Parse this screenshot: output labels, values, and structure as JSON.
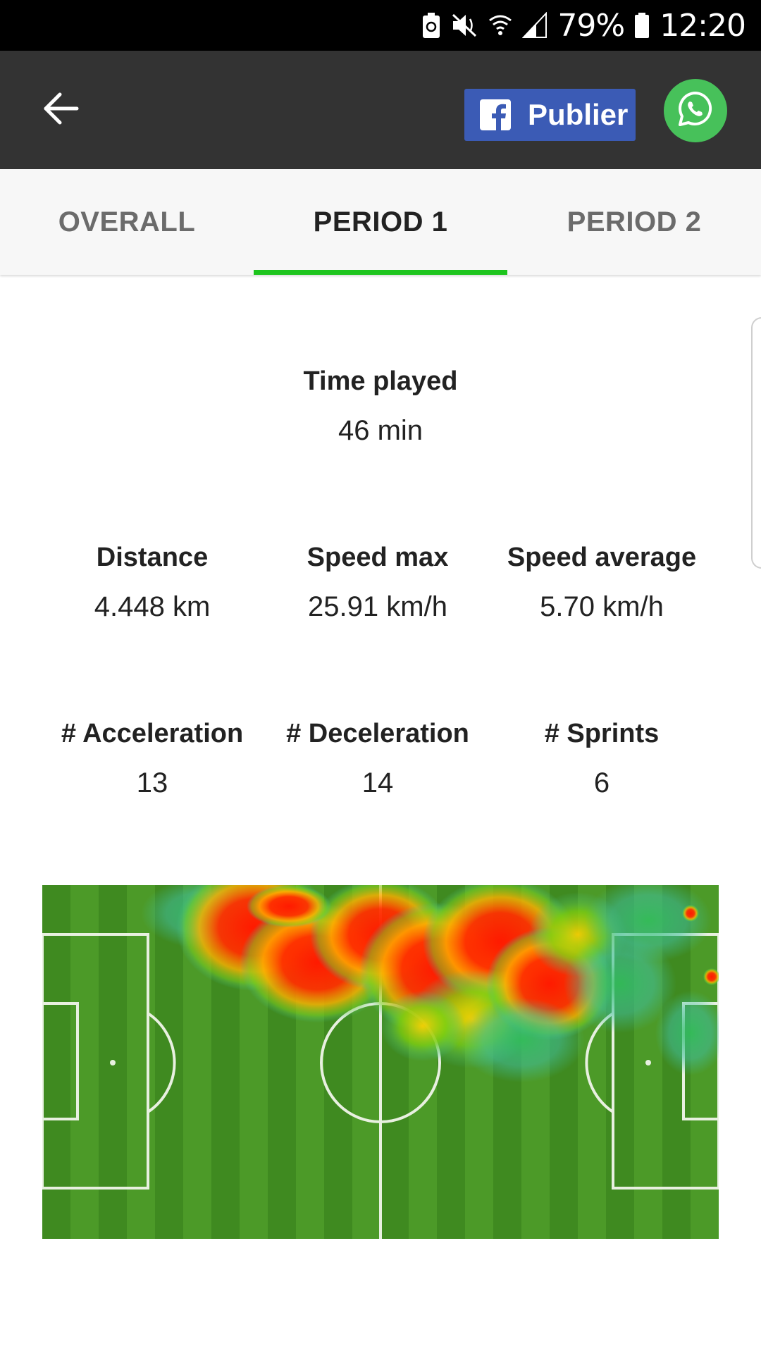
{
  "status_bar": {
    "battery_percent": "79%",
    "time": "12:20"
  },
  "app_bar": {
    "publish_label": "Publier"
  },
  "tabs": [
    {
      "label": "OVERALL",
      "active": false
    },
    {
      "label": "PERIOD 1",
      "active": true
    },
    {
      "label": "PERIOD 2",
      "active": false
    }
  ],
  "stats": {
    "time_played": {
      "label": "Time played",
      "value": "46 min"
    },
    "distance": {
      "label": "Distance",
      "value": "4.448 km"
    },
    "speed_max": {
      "label": "Speed max",
      "value": "25.91 km/h"
    },
    "speed_average": {
      "label": "Speed average",
      "value": "5.70 km/h"
    },
    "acceleration": {
      "label": "# Acceleration",
      "value": "13"
    },
    "deceleration": {
      "label": "# Deceleration",
      "value": "14"
    },
    "sprints": {
      "label": "# Sprints",
      "value": "6"
    }
  },
  "colors": {
    "app_bar": "#333333",
    "facebook": "#3b5bb5",
    "whatsapp": "#47c15a",
    "tab_indicator": "#1ec51e",
    "pitch_light": "#4c9a28",
    "pitch_dark": "#3f8a20"
  },
  "icons": {
    "back": "arrow-left-icon",
    "facebook": "facebook-icon",
    "whatsapp": "whatsapp-icon"
  }
}
